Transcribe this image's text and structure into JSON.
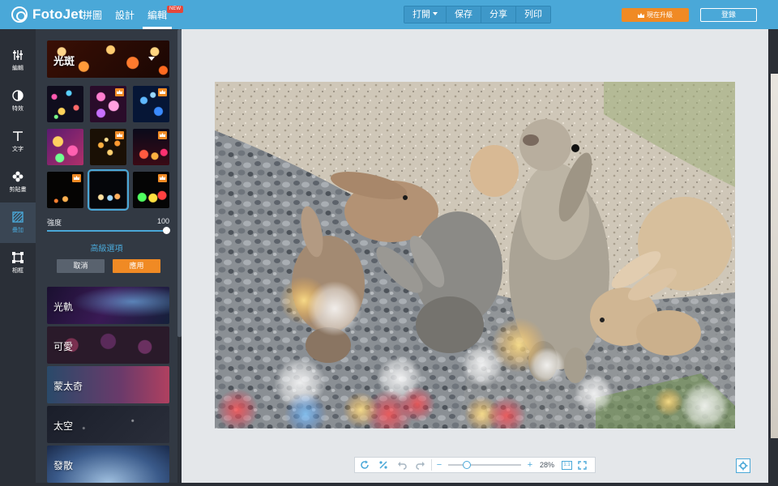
{
  "app": {
    "brand": "FotoJet"
  },
  "nav": {
    "collage": "拼圖",
    "design": "設計",
    "edit": "編輯",
    "new_badge": "NEW"
  },
  "actions": {
    "open": "打開",
    "save": "保存",
    "share": "分享",
    "print": "列印"
  },
  "account": {
    "upgrade": "現在升級",
    "login": "登錄"
  },
  "rail": {
    "edit": "編輯",
    "effects": "特效",
    "text": "文字",
    "clipart": "剪貼畫",
    "overlay": "疊加",
    "frame": "相框"
  },
  "panel": {
    "effect_title": "光斑",
    "intensity_label": "強度",
    "intensity_value": "100",
    "intensity_level": 1.0,
    "advanced": "高級選項",
    "cancel": "取消",
    "apply": "應用",
    "categories": [
      "光軌",
      "可愛",
      "蒙太奇",
      "太空",
      "發散"
    ]
  },
  "zoom": {
    "percent": "28%",
    "actual_size": "1:1"
  },
  "colors": {
    "accent": "#4aa8d8",
    "topbar": "#4aa8d8",
    "orange": "#f08a24",
    "panel": "#323943",
    "rail": "#2a2f37"
  }
}
